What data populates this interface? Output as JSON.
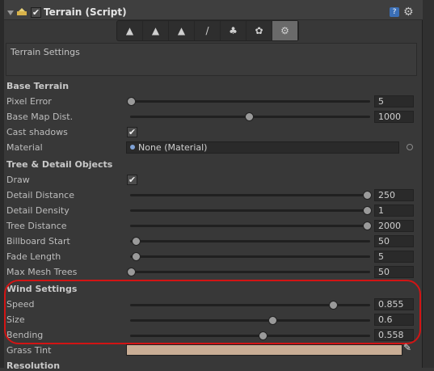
{
  "header": {
    "title": "Terrain (Script)",
    "enabled_mark": "✔"
  },
  "toolbar": {
    "buttons": [
      {
        "name": "raise-lower",
        "glyph": "▲"
      },
      {
        "name": "paint-height",
        "glyph": "▲"
      },
      {
        "name": "smooth-height",
        "glyph": "▲"
      },
      {
        "name": "paint-texture",
        "glyph": "/"
      },
      {
        "name": "place-trees",
        "glyph": "♣"
      },
      {
        "name": "paint-details",
        "glyph": "✿"
      },
      {
        "name": "settings",
        "glyph": "⚙"
      }
    ],
    "active_index": 6
  },
  "settings_box": {
    "label": "Terrain Settings"
  },
  "base_terrain": {
    "heading": "Base Terrain",
    "pixel_error": {
      "label": "Pixel Error",
      "value": "5",
      "level": 0.0
    },
    "base_map_dist": {
      "label": "Base Map Dist.",
      "value": "1000",
      "level": 0.5
    },
    "cast_shadows": {
      "label": "Cast shadows",
      "checked": "✔"
    },
    "material": {
      "label": "Material",
      "value": "None (Material)"
    }
  },
  "tree_detail": {
    "heading": "Tree & Detail Objects",
    "draw": {
      "label": "Draw",
      "checked": "✔"
    },
    "detail_distance": {
      "label": "Detail Distance",
      "value": "250",
      "level": 1.0
    },
    "detail_density": {
      "label": "Detail Density",
      "value": "1",
      "level": 1.0
    },
    "tree_distance": {
      "label": "Tree Distance",
      "value": "2000",
      "level": 1.0
    },
    "billboard_start": {
      "label": "Billboard Start",
      "value": "50",
      "level": 0.02
    },
    "fade_length": {
      "label": "Fade Length",
      "value": "5",
      "level": 0.02
    },
    "max_mesh_trees": {
      "label": "Max Mesh Trees",
      "value": "50",
      "level": 0.0
    }
  },
  "wind": {
    "heading": "Wind Settings",
    "speed": {
      "label": "Speed",
      "value": "0.855",
      "level": 0.855
    },
    "size": {
      "label": "Size",
      "value": "0.6",
      "level": 0.6
    },
    "bending": {
      "label": "Bending",
      "value": "0.558",
      "level": 0.558
    },
    "grass_tint": {
      "label": "Grass Tint",
      "color": "#c9ad95"
    }
  },
  "next_section": {
    "heading": "Resolution"
  },
  "colors": {
    "annotation": "#d21414",
    "panel": "#383838"
  }
}
